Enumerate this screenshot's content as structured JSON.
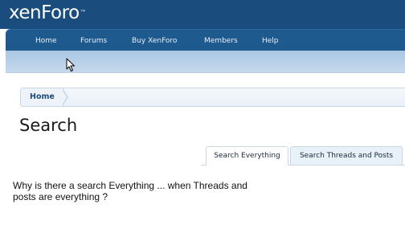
{
  "header": {
    "logo_text_a": "xen",
    "logo_text_b": "Foro",
    "logo_tm": "™"
  },
  "nav": {
    "items": [
      {
        "label": "Home"
      },
      {
        "label": "Forums"
      },
      {
        "label": "Buy XenForo"
      },
      {
        "label": "Members"
      },
      {
        "label": "Help"
      }
    ]
  },
  "breadcrumb": {
    "home_label": "Home"
  },
  "page": {
    "title": "Search"
  },
  "tabs": [
    {
      "label": "Search Everything",
      "active": true
    },
    {
      "label": "Search Threads and Posts",
      "active": false
    }
  ],
  "comment": {
    "line1": "Why is there a search Everything ... when Threads and",
    "line2": "posts are everything ?"
  },
  "colors": {
    "header_bg": "#1a4d7d",
    "nav_bg": "#1f5a8f",
    "subbar": "#b8d0e8",
    "link": "#1e4a78"
  },
  "icons": {
    "cursor": "mouse-pointer-icon"
  }
}
